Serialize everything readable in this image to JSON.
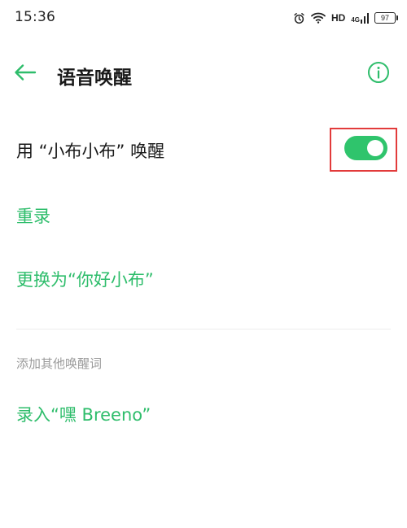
{
  "status_bar": {
    "time": "15:36",
    "hd": "HD",
    "network": "4G",
    "battery": "97",
    "icons": [
      "alarm-icon",
      "wifi-icon",
      "signal-icon",
      "battery-icon"
    ]
  },
  "header": {
    "title": "语音唤醒",
    "back_icon": "back-arrow-icon",
    "info_icon": "info-icon"
  },
  "wake_setting": {
    "label": "用 “小布小布” 唤醒",
    "enabled": true
  },
  "actions": {
    "rerecord": "重录",
    "replace": "更换为“你好小布”"
  },
  "other_words": {
    "section_label": "添加其他唤醒词",
    "record_hey": "录入“嘿 Breeno”"
  },
  "colors": {
    "accent": "#2ebd6b",
    "toggle_on": "#2fc46c",
    "highlight": "#e23b3b",
    "text_primary": "#1a1a1a",
    "text_secondary": "#9a9a9a"
  }
}
